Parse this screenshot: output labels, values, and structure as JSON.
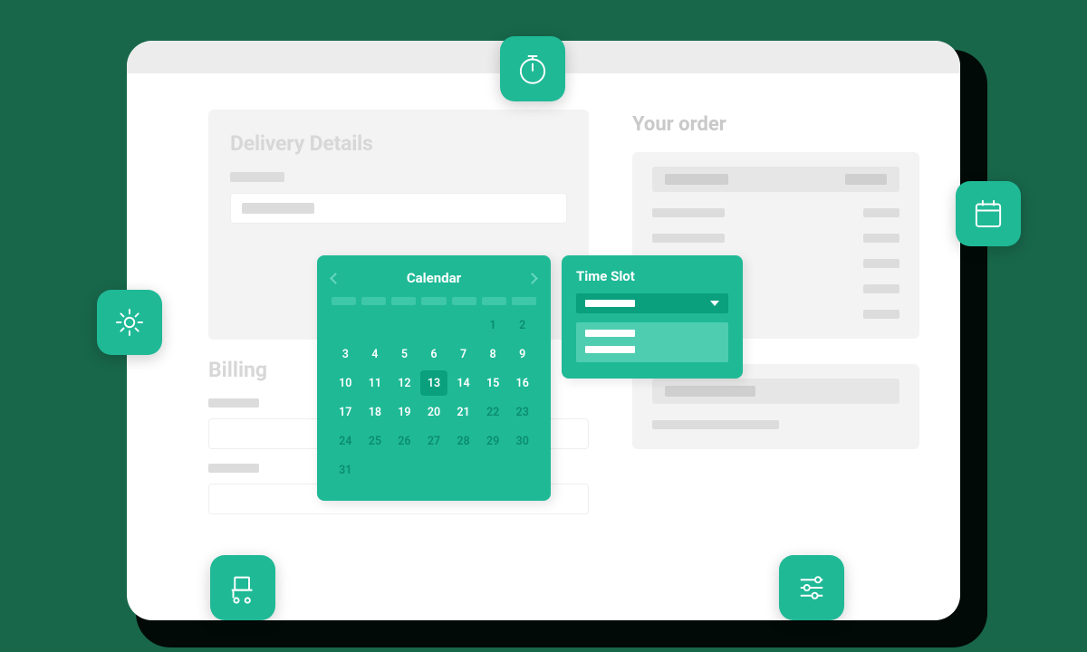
{
  "colors": {
    "accent": "#1fb996",
    "accent_dark": "#0aa07e",
    "bg": "#18674b"
  },
  "panels": {
    "delivery_title": "Delivery Details",
    "billing_title": "Billing",
    "order_title": "Your order"
  },
  "calendar": {
    "title": "Calendar",
    "selected": 13,
    "days": [
      {
        "n": "",
        "dim": true
      },
      {
        "n": "",
        "dim": true
      },
      {
        "n": "",
        "dim": true
      },
      {
        "n": "",
        "dim": true
      },
      {
        "n": "",
        "dim": true
      },
      {
        "n": 1,
        "dim": true
      },
      {
        "n": 2,
        "dim": true
      },
      {
        "n": 3
      },
      {
        "n": 4
      },
      {
        "n": 5
      },
      {
        "n": 6
      },
      {
        "n": 7
      },
      {
        "n": 8
      },
      {
        "n": 9
      },
      {
        "n": 10
      },
      {
        "n": 11
      },
      {
        "n": 12
      },
      {
        "n": 13,
        "sel": true
      },
      {
        "n": 14
      },
      {
        "n": 15
      },
      {
        "n": 16
      },
      {
        "n": 17
      },
      {
        "n": 18
      },
      {
        "n": 19
      },
      {
        "n": 20
      },
      {
        "n": 21
      },
      {
        "n": 22,
        "dim": true
      },
      {
        "n": 23,
        "dim": true
      },
      {
        "n": 24,
        "dim": true
      },
      {
        "n": 25,
        "dim": true
      },
      {
        "n": 26,
        "dim": true
      },
      {
        "n": 27,
        "dim": true
      },
      {
        "n": 28,
        "dim": true
      },
      {
        "n": 29,
        "dim": true
      },
      {
        "n": 30,
        "dim": true
      },
      {
        "n": 31,
        "dim": true
      }
    ]
  },
  "timeslot": {
    "title": "Time Slot"
  },
  "icons": {
    "timer": "timer-icon",
    "calendar": "calendar-icon",
    "gear": "gear-icon",
    "cart": "cart-icon",
    "sliders": "sliders-icon"
  }
}
